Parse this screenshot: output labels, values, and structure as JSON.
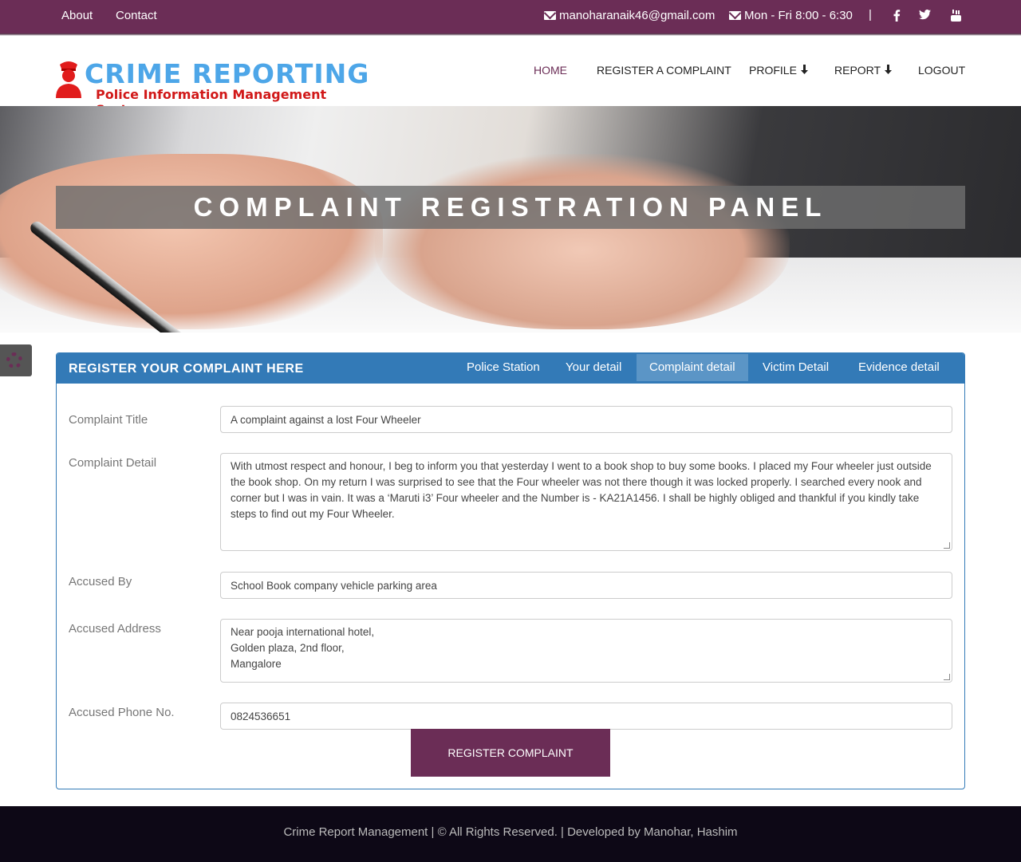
{
  "topbar": {
    "about": "About",
    "contact": "Contact",
    "email": "manoharanaik46@gmail.com",
    "hours": "Mon - Fri 8:00 - 6:30",
    "separator": "|",
    "social": [
      "facebook-icon",
      "twitter-icon",
      "youtube-icon"
    ]
  },
  "logo": {
    "title": "CRIME REPORTING",
    "subtitle": "Police Information Management System"
  },
  "nav": {
    "home": "HOME",
    "register": "REGISTER A COMPLAINT",
    "profile": "PROFILE",
    "report": "REPORT",
    "logout": "LOGOUT"
  },
  "hero": {
    "title": "COMPLAINT REGISTRATION PANEL"
  },
  "panel": {
    "title": "REGISTER YOUR COMPLAINT HERE",
    "tabs": [
      "Police Station",
      "Your detail",
      "Complaint detail",
      "Victim Detail",
      "Evidence detail"
    ],
    "active_tab": "Complaint detail"
  },
  "form": {
    "title_label": "Complaint Title",
    "title_value": "A complaint against a lost Four Wheeler",
    "detail_label": "Complaint Detail",
    "detail_value": "With utmost respect and honour, I beg to inform you that yesterday I went to a book shop to buy some books. I placed my Four wheeler just outside the book shop. On my return I was surprised to see that the Four wheeler was not there though it was locked properly. I searched every nook and corner but I was in vain. It was a ‘Maruti i3’ Four wheeler and the Number is - KA21A1456. I shall be highly obliged and thankful if you kindly take steps to find out my Four Wheeler.",
    "accused_label": "Accused By",
    "accused_value": "School Book company vehicle parking area",
    "address_label": "Accused Address",
    "address_line1": "Near pooja international hotel,",
    "address_line2": "Golden plaza, 2nd floor,",
    "address_line3": "Mangalore",
    "phone_label": "Accused Phone No.",
    "phone_value": "0824536651",
    "submit_label": "REGISTER COMPLAINT"
  },
  "footer": {
    "text": "Crime Report Management | © All Rights Reserved. | Developed by Manohar, Hashim"
  },
  "colors": {
    "brand": "#6b2d56",
    "panel_blue": "#337ab7",
    "active_tab": "#5b95c6",
    "logo_blue": "#4da6e8",
    "logo_red": "#d11818",
    "footer_bg": "#0d0816"
  }
}
